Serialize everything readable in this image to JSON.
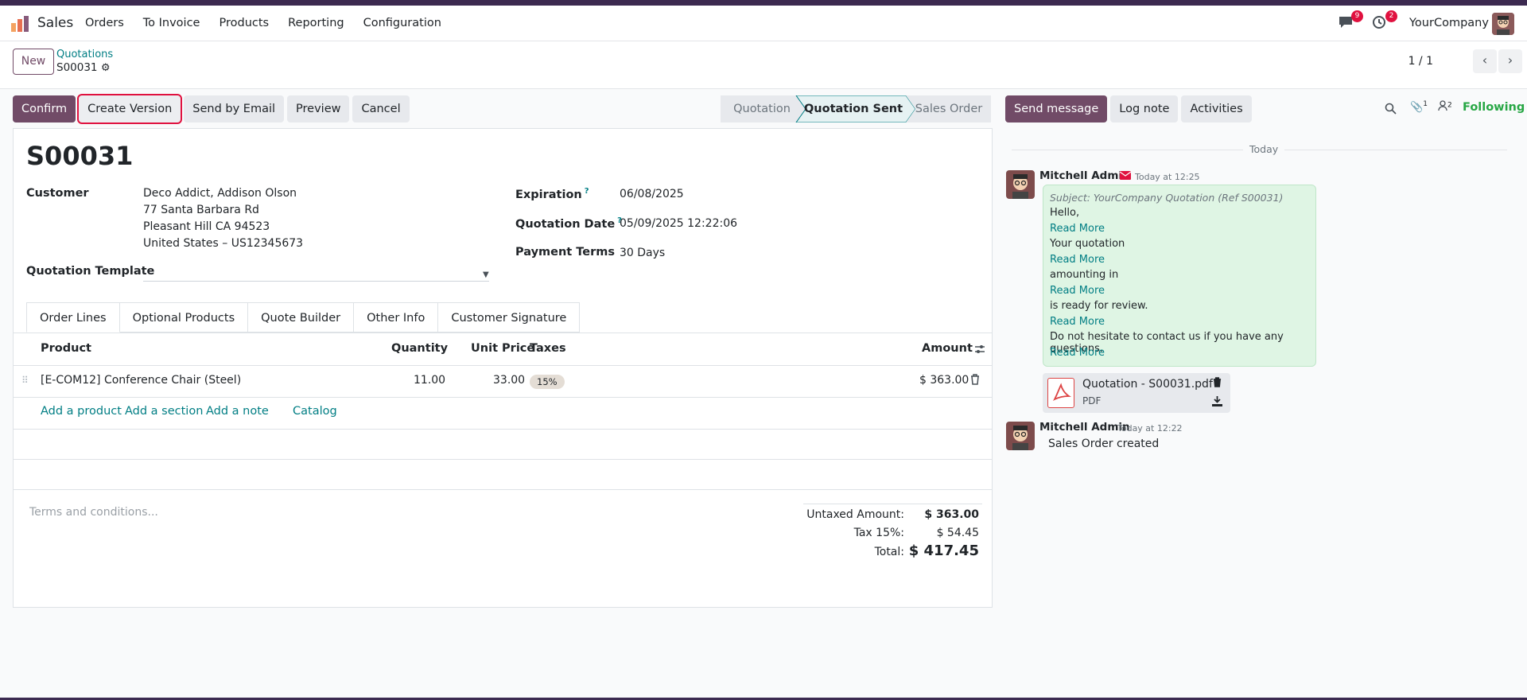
{
  "nav": {
    "app_name": "Sales",
    "menu": [
      "Orders",
      "To Invoice",
      "Products",
      "Reporting",
      "Configuration"
    ],
    "chat_badge": "9",
    "activity_badge": "2",
    "company": "YourCompany"
  },
  "control_panel": {
    "new_label": "New",
    "breadcrumb_parent": "Quotations",
    "breadcrumb_current": "S00031",
    "pager": "1 / 1"
  },
  "actions": {
    "confirm": "Confirm",
    "create_version": "Create Version",
    "send_email": "Send by Email",
    "preview": "Preview",
    "cancel": "Cancel"
  },
  "status": {
    "steps": [
      "Quotation",
      "Quotation Sent",
      "Sales Order"
    ],
    "active_index": 1
  },
  "form": {
    "title": "S00031",
    "customer_label": "Customer",
    "customer_lines": [
      "Deco Addict, Addison Olson",
      "77 Santa Barbara Rd",
      "Pleasant Hill CA 94523",
      "United States – US12345673"
    ],
    "template_label": "Quotation Template",
    "expiration_label": "Expiration",
    "expiration_value": "06/08/2025",
    "quotation_date_label": "Quotation Date",
    "quotation_date_value": "05/09/2025 12:22:06",
    "payment_terms_label": "Payment Terms",
    "payment_terms_value": "30 Days",
    "help_mark": "?"
  },
  "tabs": [
    "Order Lines",
    "Optional Products",
    "Quote Builder",
    "Other Info",
    "Customer Signature"
  ],
  "table": {
    "headers": {
      "product": "Product",
      "quantity": "Quantity",
      "unit_price": "Unit Price",
      "taxes": "Taxes",
      "amount": "Amount"
    },
    "rows": [
      {
        "product": "[E-COM12] Conference Chair (Steel)",
        "quantity": "11.00",
        "unit_price": "33.00",
        "tax": "15%",
        "amount": "$ 363.00"
      }
    ],
    "add_links": [
      "Add a product",
      "Add a section",
      "Add a note",
      "Catalog"
    ]
  },
  "terms_placeholder": "Terms and conditions...",
  "totals": {
    "untaxed_label": "Untaxed Amount:",
    "untaxed_value": "$ 363.00",
    "tax_label": "Tax 15%:",
    "tax_value": "$ 54.45",
    "total_label": "Total:",
    "total_value": "$ 417.45"
  },
  "chatter": {
    "send_message": "Send message",
    "log_note": "Log note",
    "activities": "Activities",
    "attachments_count": "1",
    "followers_count": "2",
    "following": "Following",
    "date_separator": "Today",
    "messages": [
      {
        "author": "Mitchell Admin",
        "time": "Today at 12:25",
        "lines": [
          {
            "text": "Subject: YourCompany Quotation (Ref S00031)",
            "kind": "subject"
          },
          {
            "text": "Hello,",
            "kind": "text"
          },
          {
            "text": "Read More",
            "kind": "link"
          },
          {
            "text": "Your quotation",
            "kind": "text"
          },
          {
            "text": "Read More",
            "kind": "link"
          },
          {
            "text": "amounting in",
            "kind": "text"
          },
          {
            "text": "Read More",
            "kind": "link"
          },
          {
            "text": "is ready for review.",
            "kind": "text"
          },
          {
            "text": "Read More",
            "kind": "link"
          },
          {
            "text": "Do not hesitate to contact us if you have any questions.",
            "kind": "text"
          },
          {
            "text": "Read More",
            "kind": "link"
          }
        ],
        "attachment_name": "Quotation - S00031.pdf",
        "attachment_type": "PDF"
      },
      {
        "author": "Mitchell Admin",
        "time": "Today at 12:22",
        "body": "Sales Order created"
      }
    ]
  },
  "colors": {
    "brand": "#714b67",
    "link": "#017e84",
    "highlight": "#e0113f",
    "following": "#28a745"
  }
}
